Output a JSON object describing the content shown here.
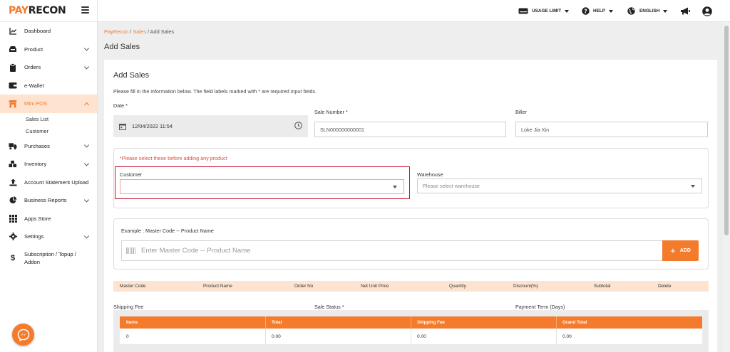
{
  "brand": {
    "part1": "PAY",
    "part2": "RECON"
  },
  "sidebar": {
    "items": [
      {
        "label": "Dashboard",
        "icon": "chart-line-icon",
        "chevron": false
      },
      {
        "label": "Product",
        "icon": "product-box-icon",
        "chevron": true
      },
      {
        "label": "Orders",
        "icon": "clipboard-icon",
        "chevron": true
      },
      {
        "label": "e-Wallet",
        "icon": "wallet-icon",
        "chevron": false
      },
      {
        "label": "Mini POS",
        "icon": "store-icon",
        "chevron": true,
        "active": true,
        "sub": [
          "Sales List",
          "Customer"
        ]
      },
      {
        "label": "Purchases",
        "icon": "truck-icon",
        "chevron": true
      },
      {
        "label": "Inventory",
        "icon": "warehouse-icon",
        "chevron": true
      },
      {
        "label": "Account Statement Upload",
        "icon": "upload-icon",
        "chevron": false
      },
      {
        "label": "Business Reports",
        "icon": "pie-chart-icon",
        "chevron": true
      },
      {
        "label": "Apps Store",
        "icon": "grid-icon",
        "chevron": false
      },
      {
        "label": "Settings",
        "icon": "gear-icon",
        "chevron": true
      },
      {
        "label": "Subscription / Topup / Addon",
        "icon": "dollar-icon",
        "chevron": false
      }
    ]
  },
  "topbar": {
    "usage_limit": "USAGE LIMIT",
    "help": "HELP",
    "language": "ENGLISH"
  },
  "breadcrumb": {
    "home": "PayRecon",
    "section": "Sales",
    "current": "Add Sales"
  },
  "page_title": "Add Sales",
  "form": {
    "title": "Add Sales",
    "description": "Please fill in the information below. The field labels marked with * are required input fields.",
    "date_label": "Date *",
    "date_value": "12/04/2022 11:54",
    "sale_number_label": "Sale Number *",
    "sale_number_value": "SLN000000000001",
    "biller_label": "Biller",
    "biller_value": "Loke Jia Xin",
    "warning": "*Please select these before adding any product",
    "customer_label": "Customer",
    "customer_value": "",
    "warehouse_label": "Warehouse",
    "warehouse_placeholder": "Please select warehouse",
    "product_example": "Example : Master Code -- Product Name",
    "product_placeholder": "Enter Master Code -- Product Name",
    "add_label": "ADD",
    "shipping_fee_label": "Shipping Fee",
    "sale_status_label": "Sale Status *",
    "payment_term_label": "Payment Term (Days)"
  },
  "item_table": {
    "headers": [
      "Master Code",
      "Product Name",
      "Order No",
      "Net Unit Price",
      "Quantity",
      "Discount(%)",
      "Subtotal",
      "Delete"
    ]
  },
  "totals_table": {
    "headers": [
      "Items",
      "Total",
      "Shipping Fee",
      "Grand Total"
    ],
    "values": [
      "0",
      "0.00",
      "0.00",
      "0.00"
    ]
  },
  "colors": {
    "accent": "#f47a2c",
    "active_bg": "#fde3d0",
    "error": "#c8102e"
  }
}
